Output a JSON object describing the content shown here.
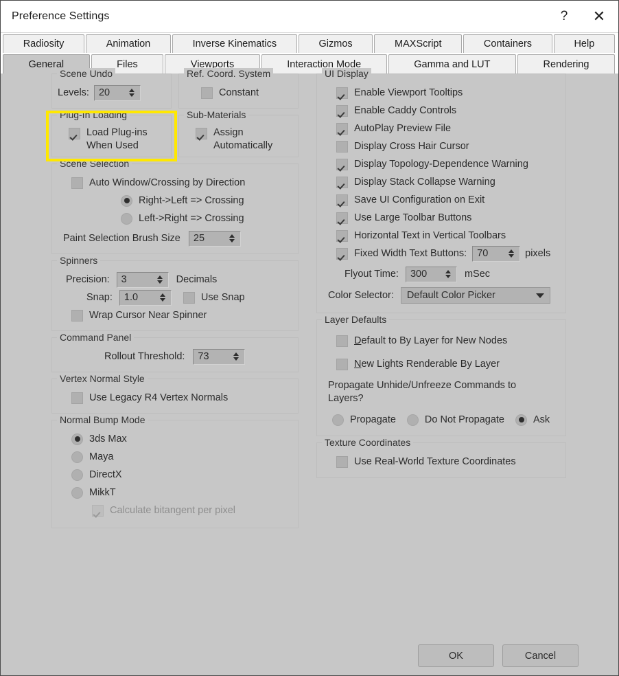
{
  "window": {
    "title": "Preference Settings",
    "help_glyph": "?",
    "close_glyph": "✕"
  },
  "tabs": {
    "row1": [
      {
        "label": "Radiosity",
        "active": false
      },
      {
        "label": "Animation",
        "active": false
      },
      {
        "label": "Inverse Kinematics",
        "active": false
      },
      {
        "label": "Gizmos",
        "active": false
      },
      {
        "label": "MAXScript",
        "active": false
      },
      {
        "label": "Containers",
        "active": false
      },
      {
        "label": "Help",
        "active": false
      }
    ],
    "row2": [
      {
        "label": "General",
        "active": true
      },
      {
        "label": "Files",
        "active": false
      },
      {
        "label": "Viewports",
        "active": false
      },
      {
        "label": "Interaction Mode",
        "active": false
      },
      {
        "label": "Gamma and LUT",
        "active": false
      },
      {
        "label": "Rendering",
        "active": false
      }
    ]
  },
  "highlight": {
    "color": "#ffe800"
  },
  "left": {
    "scene_undo": {
      "legend": "Scene Undo",
      "levels_label": "Levels:",
      "levels_value": "20"
    },
    "ref_coord": {
      "legend": "Ref. Coord. System",
      "constant_label": "Constant",
      "constant_checked": false
    },
    "plugin_loading": {
      "legend": "Plug-In Loading",
      "load_label": "Load Plug-ins When Used",
      "load_checked": true
    },
    "sub_materials": {
      "legend": "Sub-Materials",
      "assign_label": "Assign Automatically",
      "assign_checked": true
    },
    "scene_selection": {
      "legend": "Scene Selection",
      "auto_label": "Auto Window/Crossing by Direction",
      "auto_checked": false,
      "radio_right_left": "Right->Left => Crossing",
      "radio_left_right": "Left->Right => Crossing",
      "radio_selected": "right_left",
      "brush_label": "Paint Selection Brush Size",
      "brush_value": "25"
    },
    "spinners": {
      "legend": "Spinners",
      "precision_label": "Precision:",
      "precision_value": "3",
      "decimals_label": "Decimals",
      "snap_label": "Snap:",
      "snap_value": "1.0",
      "use_snap_label": "Use Snap",
      "use_snap_checked": false,
      "wrap_label": "Wrap Cursor Near Spinner",
      "wrap_checked": false
    },
    "command_panel": {
      "legend": "Command Panel",
      "rollout_label": "Rollout Threshold:",
      "rollout_value": "73"
    },
    "vertex_normal": {
      "legend": "Vertex Normal Style",
      "legacy_label": "Use Legacy R4 Vertex Normals",
      "legacy_checked": false
    },
    "normal_bump": {
      "legend": "Normal Bump Mode",
      "options": [
        {
          "label": "3ds Max",
          "selected": true
        },
        {
          "label": "Maya",
          "selected": false
        },
        {
          "label": "DirectX",
          "selected": false
        },
        {
          "label": "MikkT",
          "selected": false
        }
      ],
      "bitangent_label": "Calculate bitangent per pixel",
      "bitangent_checked": true,
      "bitangent_disabled": true
    }
  },
  "right": {
    "ui_display": {
      "legend": "UI Display",
      "checkboxes": [
        {
          "label": "Enable Viewport Tooltips",
          "checked": true
        },
        {
          "label": "Enable Caddy Controls",
          "checked": true
        },
        {
          "label": "AutoPlay Preview File",
          "checked": true
        },
        {
          "label": "Display Cross Hair Cursor",
          "checked": false
        },
        {
          "label": "Display Topology-Dependence Warning",
          "checked": true
        },
        {
          "label": "Display Stack Collapse Warning",
          "checked": true
        },
        {
          "label": "Save UI Configuration on Exit",
          "checked": true
        },
        {
          "label": "Use Large Toolbar Buttons",
          "checked": true
        },
        {
          "label": "Horizontal Text in Vertical Toolbars",
          "checked": true
        }
      ],
      "fixed_width_label": "Fixed Width Text Buttons:",
      "fixed_width_checked": true,
      "fixed_width_value": "70",
      "pixels_label": "pixels",
      "flyout_label": "Flyout Time:",
      "flyout_value": "300",
      "msec_label": "mSec",
      "color_selector_label": "Color Selector:",
      "color_selector_value": "Default Color Picker"
    },
    "layer_defaults": {
      "legend": "Layer Defaults",
      "default_bylayer_mnemonic": "D",
      "default_bylayer_label": "efault to By Layer for New Nodes",
      "default_bylayer_checked": false,
      "new_lights_mnemonic": "N",
      "new_lights_label": "ew Lights Renderable By Layer",
      "new_lights_checked": false,
      "propagate_question": "Propagate Unhide/Unfreeze Commands to Layers?",
      "options": [
        {
          "label": "Propagate",
          "selected": false
        },
        {
          "label": "Do Not Propagate",
          "selected": false
        },
        {
          "label": "Ask",
          "selected": true
        }
      ]
    },
    "texture_coords": {
      "legend": "Texture Coordinates",
      "realworld_label": "Use Real-World Texture Coordinates",
      "realworld_checked": false
    }
  },
  "footer": {
    "ok_label": "OK",
    "cancel_label": "Cancel"
  }
}
